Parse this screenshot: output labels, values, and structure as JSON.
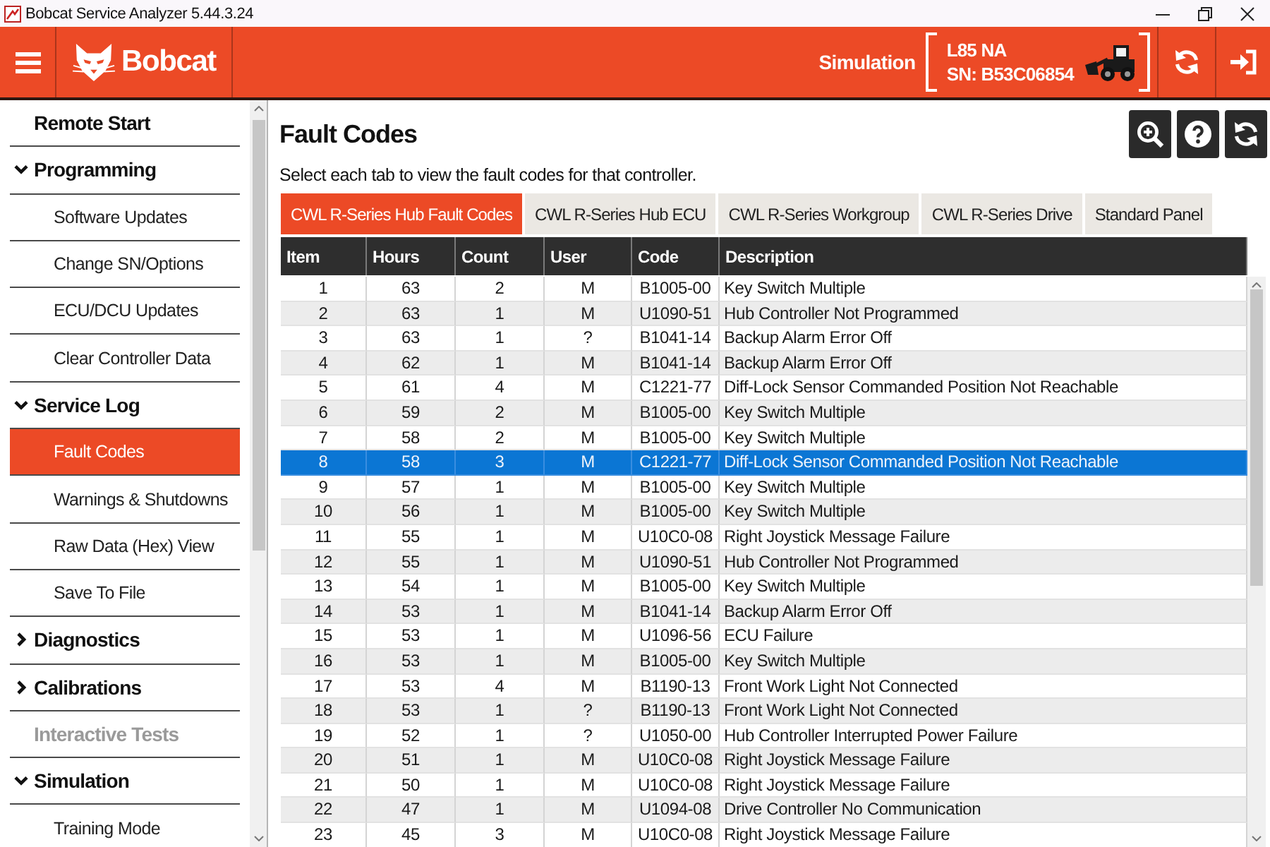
{
  "window": {
    "title": "Bobcat Service Analyzer 5.44.3.24"
  },
  "header": {
    "logo_text": "Bobcat",
    "mode": "Simulation",
    "machine_model": "L85 NA",
    "serial_number": "SN: B53C06854"
  },
  "sidebar": {
    "items": [
      {
        "label": "Remote Start",
        "selected": false,
        "disabled": false
      },
      {
        "label": "Programming",
        "expanded": true,
        "selected": false,
        "disabled": false,
        "children": [
          {
            "label": "Software Updates",
            "selected": false
          },
          {
            "label": "Change SN/Options",
            "selected": false
          },
          {
            "label": "ECU/DCU Updates",
            "selected": false
          },
          {
            "label": "Clear Controller Data",
            "selected": false
          }
        ]
      },
      {
        "label": "Service Log",
        "expanded": true,
        "selected": false,
        "disabled": false,
        "children": [
          {
            "label": "Fault Codes",
            "selected": true
          },
          {
            "label": "Warnings & Shutdowns",
            "selected": false
          },
          {
            "label": "Raw Data (Hex) View",
            "selected": false
          },
          {
            "label": "Save To File",
            "selected": false
          }
        ]
      },
      {
        "label": "Diagnostics",
        "expanded": false,
        "selected": false,
        "disabled": false
      },
      {
        "label": "Calibrations",
        "expanded": false,
        "selected": false,
        "disabled": false
      },
      {
        "label": "Interactive Tests",
        "selected": false,
        "disabled": true
      },
      {
        "label": "Simulation",
        "expanded": true,
        "selected": false,
        "disabled": false,
        "children": [
          {
            "label": "Training Mode",
            "selected": false
          }
        ]
      }
    ]
  },
  "page": {
    "title": "Fault Codes",
    "instructions": "Select each tab to view the fault codes for that controller."
  },
  "tabs": [
    {
      "label": "CWL R-Series Hub Fault Codes",
      "selected": true
    },
    {
      "label": "CWL R-Series Hub ECU",
      "selected": false
    },
    {
      "label": "CWL R-Series Workgroup",
      "selected": false
    },
    {
      "label": "CWL R-Series Drive",
      "selected": false
    },
    {
      "label": "Standard Panel",
      "selected": false
    }
  ],
  "table": {
    "columns": [
      "Item",
      "Hours",
      "Count",
      "User",
      "Code",
      "Description"
    ],
    "rows": [
      {
        "cells": [
          "1",
          "63",
          "2",
          "M",
          "B1005-00",
          "Key Switch Multiple"
        ],
        "selected": false
      },
      {
        "cells": [
          "2",
          "63",
          "1",
          "M",
          "U1090-51",
          "Hub Controller Not Programmed"
        ],
        "selected": false
      },
      {
        "cells": [
          "3",
          "63",
          "1",
          "?",
          "B1041-14",
          "Backup Alarm Error Off"
        ],
        "selected": false
      },
      {
        "cells": [
          "4",
          "62",
          "1",
          "M",
          "B1041-14",
          "Backup Alarm Error Off"
        ],
        "selected": false
      },
      {
        "cells": [
          "5",
          "61",
          "4",
          "M",
          "C1221-77",
          "Diff-Lock Sensor Commanded Position Not Reachable"
        ],
        "selected": false
      },
      {
        "cells": [
          "6",
          "59",
          "2",
          "M",
          "B1005-00",
          "Key Switch Multiple"
        ],
        "selected": false
      },
      {
        "cells": [
          "7",
          "58",
          "2",
          "M",
          "B1005-00",
          "Key Switch Multiple"
        ],
        "selected": false
      },
      {
        "cells": [
          "8",
          "58",
          "3",
          "M",
          "C1221-77",
          "Diff-Lock Sensor Commanded Position Not Reachable"
        ],
        "selected": true
      },
      {
        "cells": [
          "9",
          "57",
          "1",
          "M",
          "B1005-00",
          "Key Switch Multiple"
        ],
        "selected": false
      },
      {
        "cells": [
          "10",
          "56",
          "1",
          "M",
          "B1005-00",
          "Key Switch Multiple"
        ],
        "selected": false
      },
      {
        "cells": [
          "11",
          "55",
          "1",
          "M",
          "U10C0-08",
          "Right Joystick Message Failure"
        ],
        "selected": false
      },
      {
        "cells": [
          "12",
          "55",
          "1",
          "M",
          "U1090-51",
          "Hub Controller Not Programmed"
        ],
        "selected": false
      },
      {
        "cells": [
          "13",
          "54",
          "1",
          "M",
          "B1005-00",
          "Key Switch Multiple"
        ],
        "selected": false
      },
      {
        "cells": [
          "14",
          "53",
          "1",
          "M",
          "B1041-14",
          "Backup Alarm Error Off"
        ],
        "selected": false
      },
      {
        "cells": [
          "15",
          "53",
          "1",
          "M",
          "U1096-56",
          "ECU Failure"
        ],
        "selected": false
      },
      {
        "cells": [
          "16",
          "53",
          "1",
          "M",
          "B1005-00",
          "Key Switch Multiple"
        ],
        "selected": false
      },
      {
        "cells": [
          "17",
          "53",
          "4",
          "M",
          "B1190-13",
          "Front Work Light Not Connected"
        ],
        "selected": false
      },
      {
        "cells": [
          "18",
          "53",
          "1",
          "?",
          "B1190-13",
          "Front Work Light Not Connected"
        ],
        "selected": false
      },
      {
        "cells": [
          "19",
          "52",
          "1",
          "?",
          "U1050-00",
          "Hub Controller Interrupted Power Failure"
        ],
        "selected": false
      },
      {
        "cells": [
          "20",
          "51",
          "1",
          "M",
          "U10C0-08",
          "Right Joystick Message Failure"
        ],
        "selected": false
      },
      {
        "cells": [
          "21",
          "50",
          "1",
          "M",
          "U10C0-08",
          "Right Joystick Message Failure"
        ],
        "selected": false
      },
      {
        "cells": [
          "22",
          "47",
          "1",
          "M",
          "U1094-08",
          "Drive Controller No Communication"
        ],
        "selected": false
      },
      {
        "cells": [
          "23",
          "45",
          "3",
          "M",
          "U10C0-08",
          "Right Joystick Message Failure"
        ],
        "selected": false
      }
    ]
  }
}
